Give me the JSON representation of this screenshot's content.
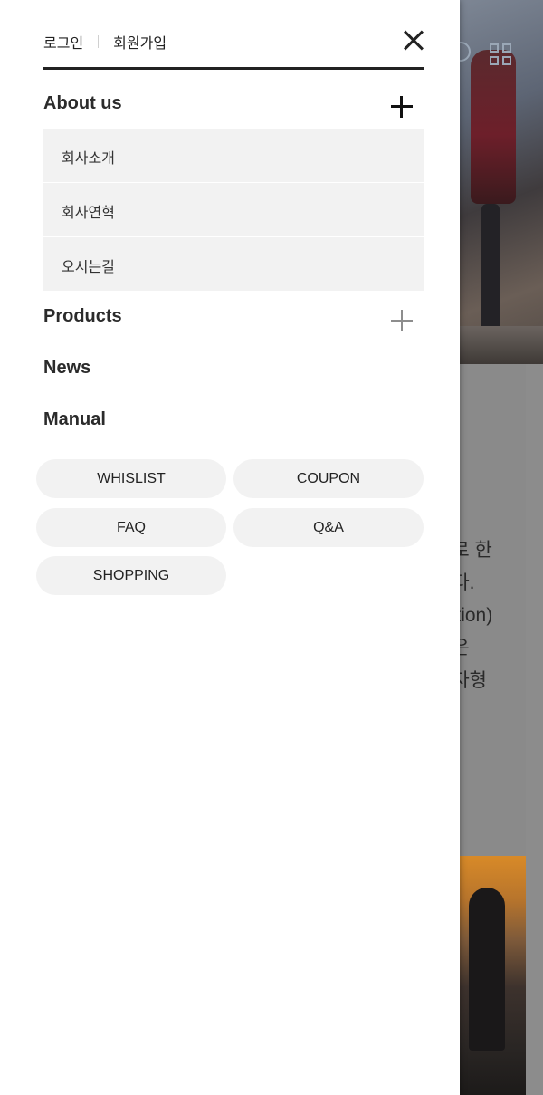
{
  "auth": {
    "login": "로그인",
    "signup": "회원가입"
  },
  "menu": {
    "about": {
      "label": "About us",
      "children": [
        "회사소개",
        "회사연혁",
        "오시는길"
      ]
    },
    "products": {
      "label": "Products"
    },
    "news": {
      "label": "News"
    },
    "manual": {
      "label": "Manual"
    }
  },
  "quick_links": [
    "WHISLIST",
    "COUPON",
    "FAQ",
    "Q&A",
    "SHOPPING"
  ],
  "background": {
    "text_lines": [
      "으로 한",
      "니다.",
      "nation)",
      "형은",
      "투자형"
    ]
  },
  "colors": {
    "panel_bg": "#ffffff",
    "submenu_bg": "#f2f2f2",
    "pill_bg": "#f2f2f2",
    "text": "#222222",
    "overlay": "#8a8a8a"
  }
}
